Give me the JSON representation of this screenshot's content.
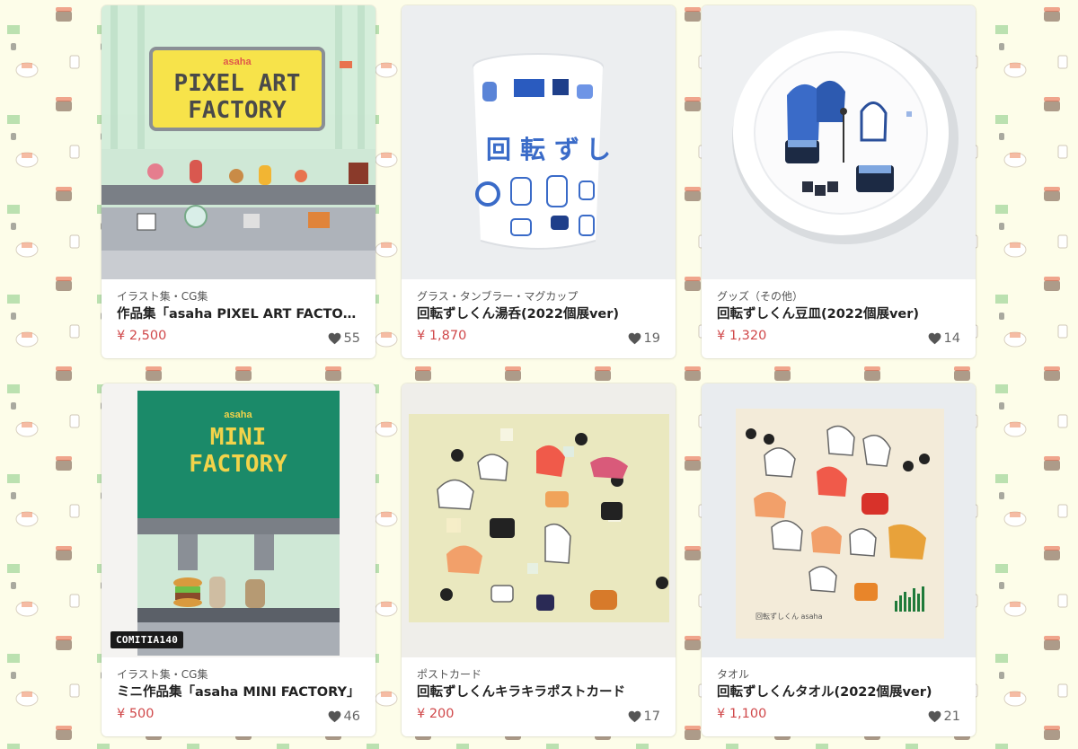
{
  "products": [
    {
      "category": "イラスト集・CG集",
      "title": "作品集「asaha PIXEL ART FACTORY」",
      "price": "¥ 2,500",
      "likes": "55",
      "image_text": {
        "brand": "asaha",
        "line1": "PIXEL ART",
        "line2": "FACTORY"
      },
      "badge": ""
    },
    {
      "category": "グラス・タンブラー・マグカップ",
      "title": "回転ずしくん湯呑(2022個展ver)",
      "price": "¥ 1,870",
      "likes": "19",
      "image_text": {
        "c1": "回",
        "c2": "転",
        "c3": "ず",
        "c4": "し"
      },
      "badge": ""
    },
    {
      "category": "グッズ（その他）",
      "title": "回転ずしくん豆皿(2022個展ver)",
      "price": "¥ 1,320",
      "likes": "14",
      "badge": ""
    },
    {
      "category": "イラスト集・CG集",
      "title": "ミニ作品集「asaha MINI FACTORY」",
      "price": "¥ 500",
      "likes": "46",
      "image_text": {
        "brand": "asaha",
        "line1": "MINI",
        "line2": "FACTORY"
      },
      "badge": "COMITIA140"
    },
    {
      "category": "ポストカード",
      "title": "回転ずしくんキラキラポストカード",
      "price": "¥ 200",
      "likes": "17",
      "badge": ""
    },
    {
      "category": "タオル",
      "title": "回転ずしくんタオル(2022個展ver)",
      "price": "¥ 1,100",
      "likes": "21",
      "image_text": {
        "tag": "回転ずしくん asaha"
      },
      "badge": ""
    }
  ],
  "colors": {
    "background": "#fdfde9",
    "price": "#d0484a",
    "factory_yellow": "#f7e34a",
    "mini_factory_green": "#1d8a6a",
    "badge": "#1a1a1a"
  }
}
